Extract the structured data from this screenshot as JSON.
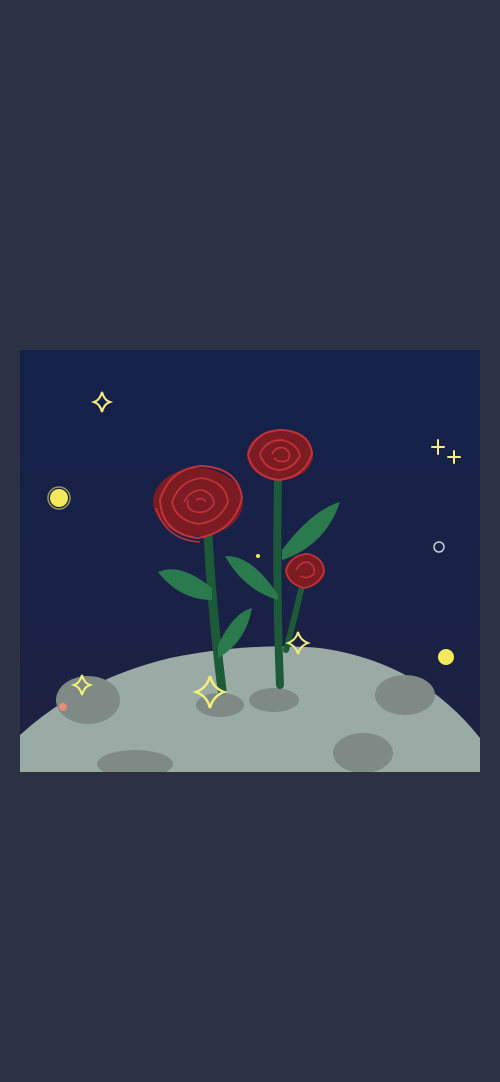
{
  "screen": {
    "background_color": "#2d3144"
  },
  "artwork": {
    "subject": "roses-on-moon-illustration",
    "colors": {
      "sky_top": "#15214a",
      "sky_bottom": "#1d2240",
      "moon_surface": "#9aaaa5",
      "crater": "#7c8683",
      "rose_red": "#8a1f24",
      "rose_line": "#c0333a",
      "stem_green": "#1c5a3a",
      "leaf_green": "#2a7a4e",
      "star_yellow": "#f3ef7a",
      "planet_yellow": "#f2ea5a"
    }
  }
}
